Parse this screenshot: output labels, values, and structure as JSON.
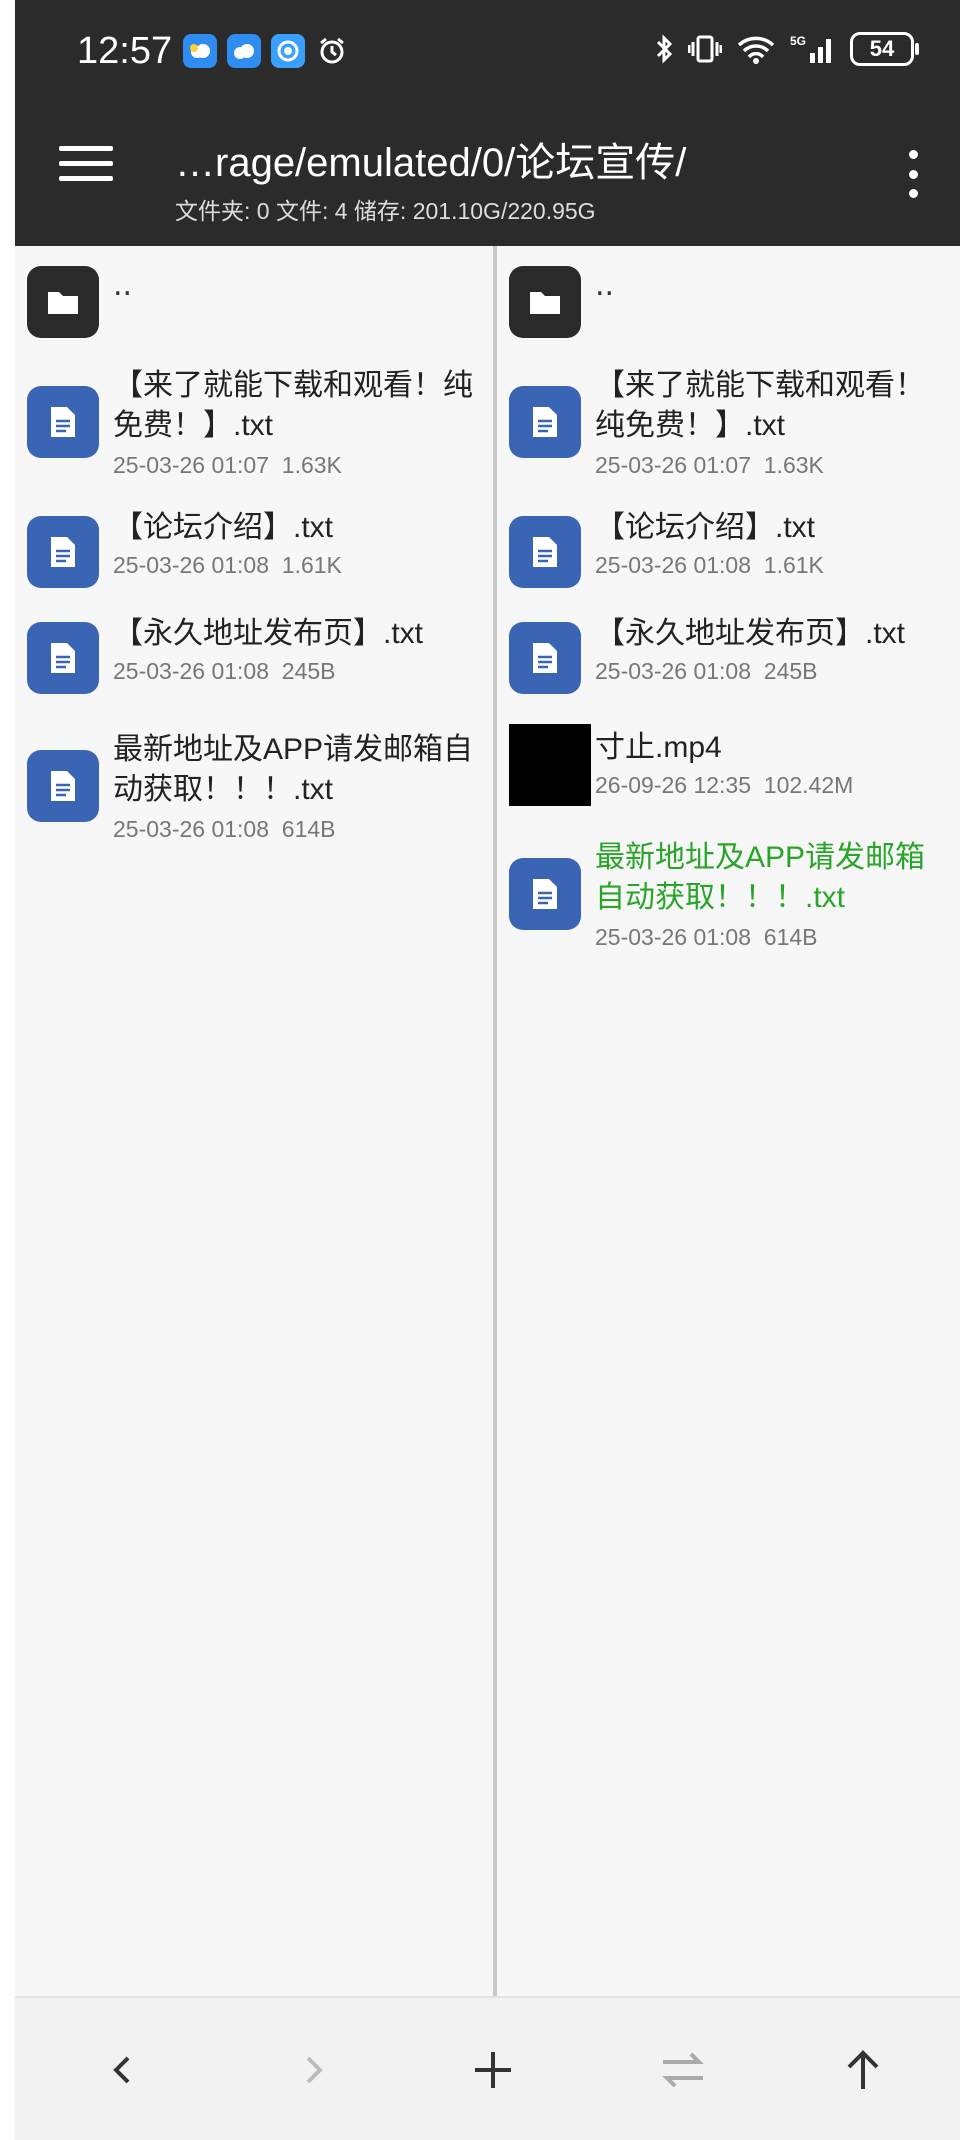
{
  "status": {
    "time": "12:57",
    "battery": "54"
  },
  "header": {
    "path": "…rage/emulated/0/论坛宣传/",
    "info": "文件夹: 0  文件: 4  储存: 201.10G/220.95G"
  },
  "left_pane": {
    "up_label": "..",
    "files": [
      {
        "name": "【来了就能下载和观看！纯免费！】.txt",
        "date": "25-03-26 01:07",
        "size": "1.63K",
        "icon": "document-icon"
      },
      {
        "name": "【论坛介绍】.txt",
        "date": "25-03-26 01:08",
        "size": "1.61K",
        "icon": "document-icon"
      },
      {
        "name": "【永久地址发布页】.txt",
        "date": "25-03-26 01:08",
        "size": "245B",
        "icon": "document-icon"
      },
      {
        "name": "最新地址及APP请发邮箱自动获取！！！.txt",
        "date": "25-03-26 01:08",
        "size": "614B",
        "icon": "document-icon"
      }
    ]
  },
  "right_pane": {
    "up_label": "..",
    "files": [
      {
        "name": "【来了就能下载和观看！纯免费！】.txt",
        "date": "25-03-26 01:07",
        "size": "1.63K",
        "icon": "document-icon"
      },
      {
        "name": "【论坛介绍】.txt",
        "date": "25-03-26 01:08",
        "size": "1.61K",
        "icon": "document-icon"
      },
      {
        "name": "【永久地址发布页】.txt",
        "date": "25-03-26 01:08",
        "size": "245B",
        "icon": "document-icon"
      },
      {
        "name": "寸止.mp4",
        "date": "26-09-26 12:35",
        "size": "102.42M",
        "icon": "video-thumbnail"
      },
      {
        "name": "最新地址及APP请发邮箱自动获取！！！.txt",
        "date": "25-03-26 01:08",
        "size": "614B",
        "icon": "document-icon",
        "highlight": "#2aa52a"
      }
    ]
  },
  "bottom_bar": {
    "buttons": [
      "back-arrow-icon",
      "forward-arrow-icon",
      "plus-icon",
      "swap-icon",
      "up-arrow-icon"
    ]
  },
  "colors": {
    "header_bg": "#2b2b2b",
    "doc_icon": "#3a64b4",
    "highlight": "#2aa52a"
  }
}
